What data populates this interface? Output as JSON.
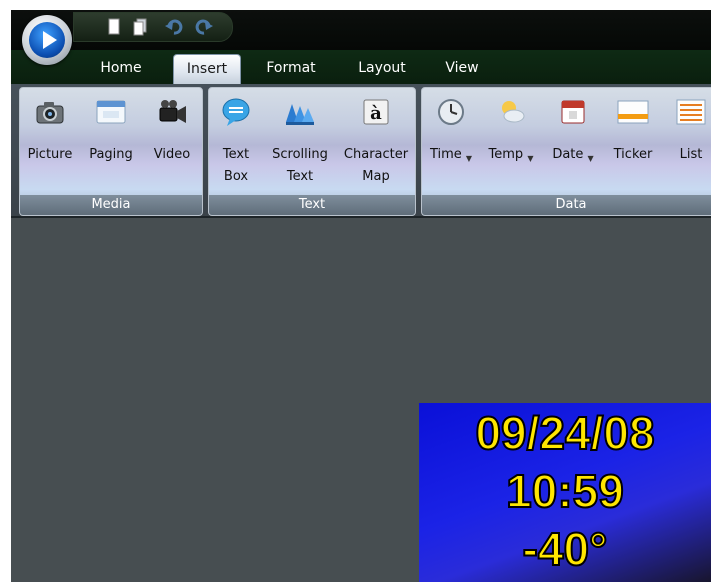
{
  "tabs": [
    {
      "label": "Home"
    },
    {
      "label": "Insert"
    },
    {
      "label": "Format"
    },
    {
      "label": "Layout"
    },
    {
      "label": "View"
    }
  ],
  "active_tab": "Insert",
  "groups": {
    "media": {
      "label": "Media",
      "buttons": [
        {
          "line1": "Picture",
          "icon": "camera-icon"
        },
        {
          "line1": "Paging",
          "icon": "paging-window-icon"
        },
        {
          "line1": "Video",
          "icon": "video-camera-icon"
        }
      ]
    },
    "text": {
      "label": "Text",
      "buttons": [
        {
          "line1": "Text",
          "line2": "Box",
          "icon": "speech-bubble-icon"
        },
        {
          "line1": "Scrolling",
          "line2": "Text",
          "icon": "scrolling-text-icon"
        },
        {
          "line1": "Character",
          "line2": "Map",
          "icon": "character-map-icon"
        }
      ]
    },
    "data": {
      "label": "Data",
      "buttons": [
        {
          "line1": "Time",
          "icon": "clock-icon",
          "dropdown": true
        },
        {
          "line1": "Temp",
          "icon": "weather-icon",
          "dropdown": true
        },
        {
          "line1": "Date",
          "icon": "calendar-icon",
          "dropdown": true
        },
        {
          "line1": "Ticker",
          "icon": "ticker-icon"
        },
        {
          "line1": "List",
          "icon": "list-icon"
        }
      ]
    }
  },
  "preview": {
    "date": "09/24/08",
    "time": "10:59",
    "temp": "-40°"
  },
  "colors": {
    "tab_bar": "#0e2a14",
    "workspace": "#474e51",
    "preview_text": "#ffe600",
    "preview_bg": "#1b23e6"
  }
}
